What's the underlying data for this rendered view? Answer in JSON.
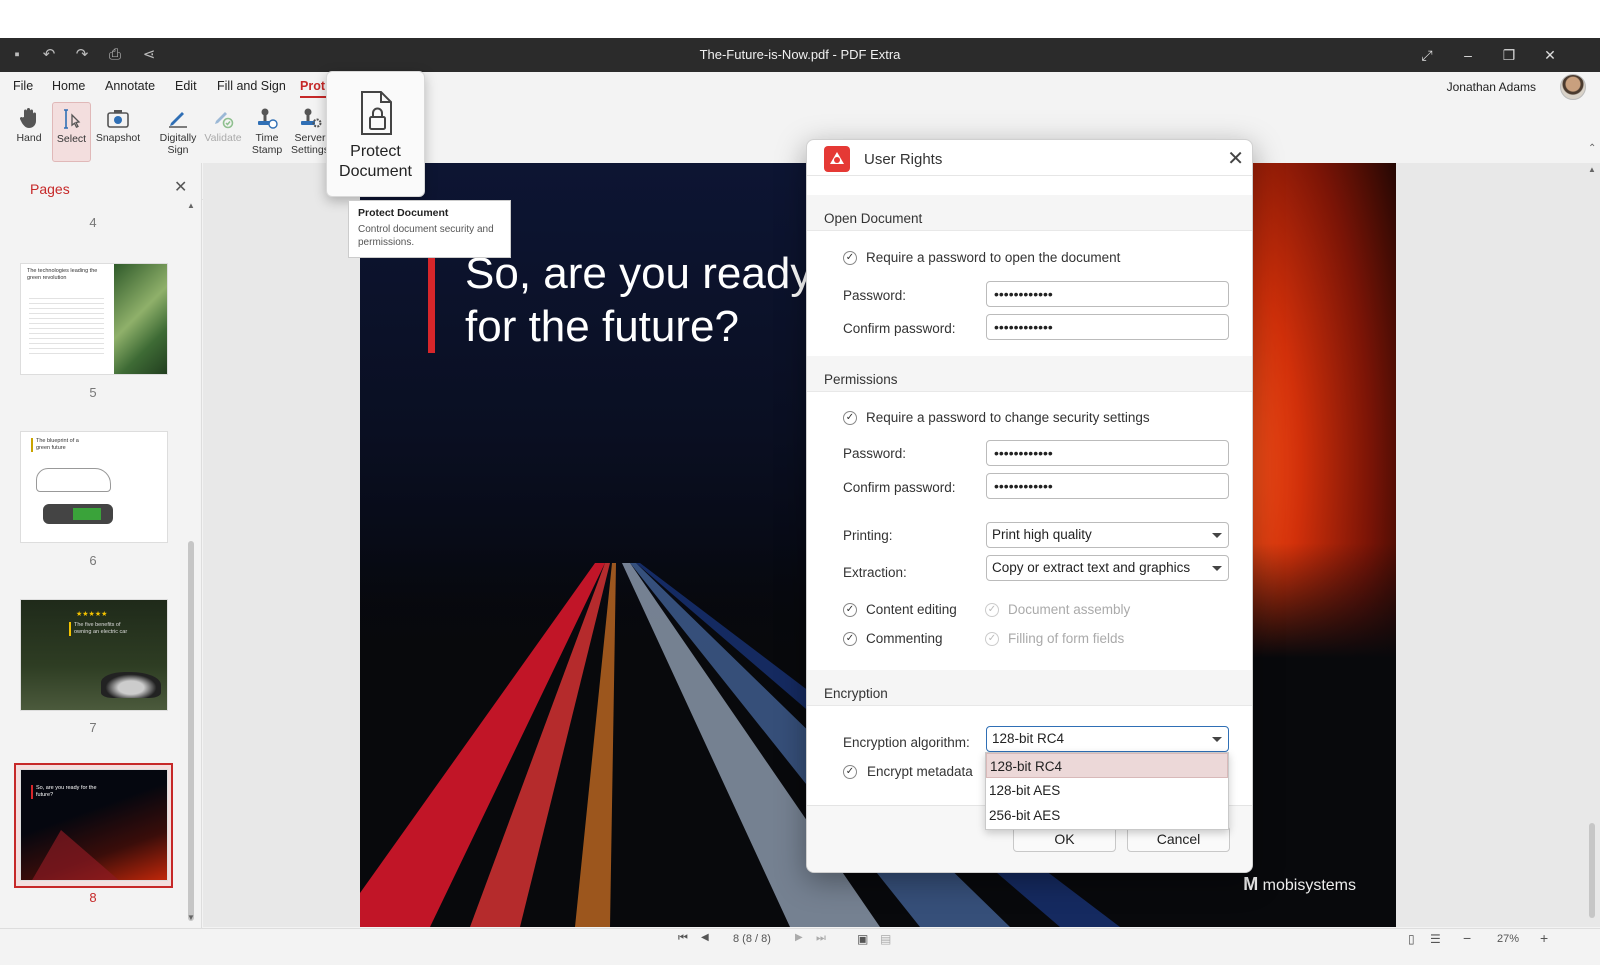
{
  "window": {
    "title": "The-Future-is-Now.pdf - PDF Extra"
  },
  "menu": {
    "items": [
      "File",
      "Home",
      "Annotate",
      "Edit",
      "Fill and Sign",
      "Prot"
    ],
    "active_index": 5
  },
  "user": {
    "name": "Jonathan Adams"
  },
  "ribbon": {
    "tools": [
      {
        "label": "Hand",
        "icon": "hand-icon"
      },
      {
        "label": "Select",
        "icon": "select-text-icon"
      },
      {
        "label": "Snapshot",
        "icon": "camera-icon"
      },
      {
        "label": "Digitally Sign",
        "icon": "sign-pen-icon"
      },
      {
        "label": "Validate",
        "icon": "validate-icon"
      },
      {
        "label": "Time Stamp",
        "icon": "stamp-icon"
      },
      {
        "label": "Server Settings",
        "icon": "server-gear-icon"
      }
    ]
  },
  "tooltip": {
    "big_label": "Protect Document",
    "title": "Protect Document",
    "description": "Control document security and permissions."
  },
  "pages_panel": {
    "header": "Pages",
    "page_numbers": [
      "4",
      "5",
      "6",
      "7",
      "8"
    ],
    "thumb_texts": {
      "p5": "The technologies leading the green revolution",
      "p6": "The blueprint of a green future",
      "p7": "The five benefits of owning an electric car",
      "p8": "So, are you ready for the future?"
    },
    "selected_page": "8"
  },
  "slide": {
    "headline_line1": "So, are you ready",
    "headline_line2": "for the future?",
    "brand": "mobisystems"
  },
  "status": {
    "page_indicator": "8 (8 / 8)",
    "zoom": "27%"
  },
  "dialog": {
    "title": "User Rights",
    "open_document": {
      "section": "Open Document",
      "require_label": "Require a password to open the document",
      "require_checked": true,
      "password_label": "Password:",
      "password_value": "••••••••••••",
      "confirm_label": "Confirm password:",
      "confirm_value": "••••••••••••"
    },
    "permissions": {
      "section": "Permissions",
      "require_label": "Require a password to change security settings",
      "require_checked": true,
      "password_label": "Password:",
      "password_value": "••••••••••••",
      "confirm_label": "Confirm password:",
      "confirm_value": "••••••••••••",
      "printing_label": "Printing:",
      "printing_value": "Print high quality",
      "extraction_label": "Extraction:",
      "extraction_value": "Copy or extract text and graphics",
      "content_editing": "Content editing",
      "document_assembly": "Document assembly",
      "commenting": "Commenting",
      "filling_forms": "Filling of form fields"
    },
    "encryption": {
      "section": "Encryption",
      "algorithm_label": "Encryption algorithm:",
      "algorithm_value": "128-bit RC4",
      "options": [
        "128-bit RC4",
        "128-bit AES",
        "256-bit AES"
      ],
      "highlighted_index": 0,
      "metadata_label": "Encrypt metadata"
    },
    "ok_label": "OK",
    "cancel_label": "Cancel"
  },
  "colors": {
    "accent": "#c62828",
    "titlebar": "#2b2b2b",
    "dialog_logo": "#e53935"
  }
}
